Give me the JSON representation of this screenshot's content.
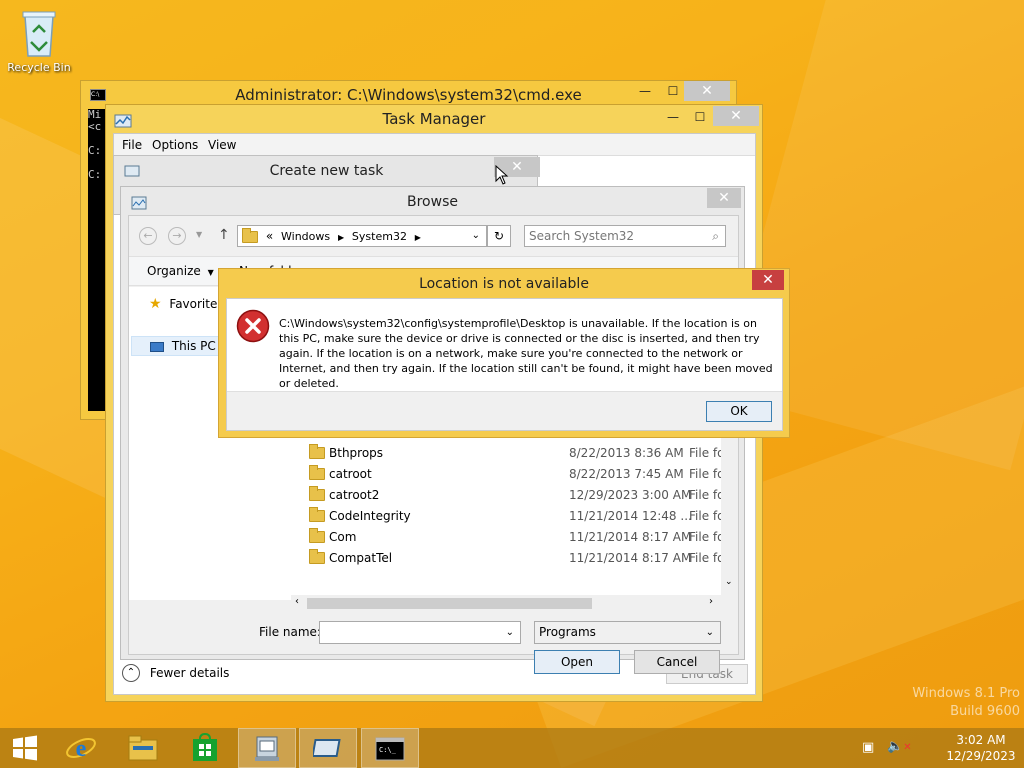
{
  "desktop": {
    "recycle_bin_label": "Recycle Bin",
    "watermark_line1": "Windows 8.1 Pro",
    "watermark_line2": "Build 9600"
  },
  "cmd": {
    "title": "Administrator: C:\\Windows\\system32\\cmd.exe",
    "lines": [
      "Mi",
      "<c",
      "",
      "C:",
      "",
      "C:"
    ]
  },
  "task_manager": {
    "title": "Task Manager",
    "menu": [
      "File",
      "Options",
      "View"
    ],
    "fewer_details": "Fewer details",
    "end_task": "End task"
  },
  "create_task": {
    "title": "Create new task"
  },
  "browse": {
    "title": "Browse",
    "breadcrumb": [
      "«",
      "Windows",
      "System32"
    ],
    "search_placeholder": "Search System32",
    "organize": "Organize",
    "new_folder": "New folder",
    "nav": [
      "Favorites",
      "This PC"
    ],
    "files": [
      {
        "name": "Bthprops",
        "date": "8/22/2013 8:36 AM",
        "type": "File fol"
      },
      {
        "name": "catroot",
        "date": "8/22/2013 7:45 AM",
        "type": "File fol"
      },
      {
        "name": "catroot2",
        "date": "12/29/2023 3:00 AM",
        "type": "File fol"
      },
      {
        "name": "CodeIntegrity",
        "date": "11/21/2014 12:48 ...",
        "type": "File fol"
      },
      {
        "name": "Com",
        "date": "11/21/2014 8:17 AM",
        "type": "File fol"
      },
      {
        "name": "CompatTel",
        "date": "11/21/2014 8:17 AM",
        "type": "File fol"
      }
    ],
    "file_name_label": "File name:",
    "file_name_value": "",
    "file_type": "Programs",
    "open": "Open",
    "cancel": "Cancel"
  },
  "error_dialog": {
    "title": "Location is not available",
    "message": "C:\\Windows\\system32\\config\\systemprofile\\Desktop is unavailable. If the location is on this PC, make sure the device or drive is connected or the disc is inserted, and then try again. If the location is on a network, make sure you're connected to the network or Internet, and then try again. If the location still can't be found, it might have been moved or deleted.",
    "ok": "OK"
  },
  "taskbar": {
    "time": "3:02 AM",
    "date": "12/29/2023"
  },
  "colors": {
    "desktop": "#f7b21a",
    "window_frame": "#f6c940",
    "close_red": "#c74040",
    "error_red": "#cc2222"
  }
}
